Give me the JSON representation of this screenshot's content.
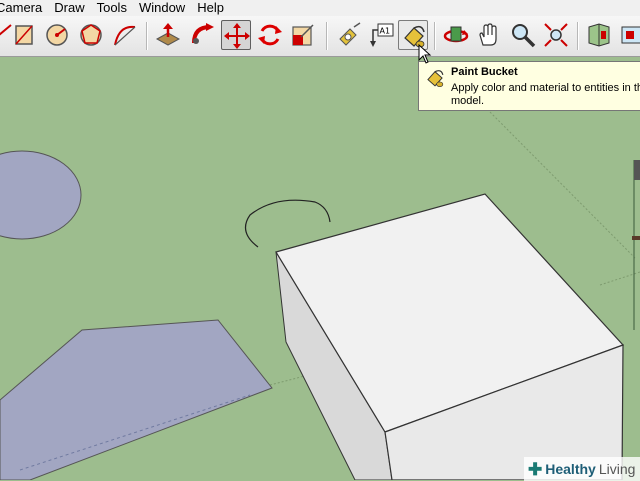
{
  "menu": {
    "items": [
      "Camera",
      "Draw",
      "Tools",
      "Window",
      "Help"
    ]
  },
  "toolbar": {
    "tools": [
      "rectangle-icon",
      "circle-icon",
      "polygon-icon",
      "arc-icon",
      "push-pull-icon",
      "follow-me-icon",
      "move-icon",
      "rotate-icon",
      "scale-icon",
      "tape-measure-icon",
      "text-icon",
      "paint-bucket-icon",
      "orbit-icon",
      "pan-icon",
      "zoom-icon",
      "zoom-extents-icon",
      "components-icon",
      "styles-icon"
    ],
    "text_tool_label": "A1",
    "active_tool": "paint-bucket-icon",
    "pressed_tool": "move-icon"
  },
  "tooltip": {
    "title": "Paint Bucket",
    "text": "Apply color and material to entities in the model."
  },
  "canvas": {
    "background_color": "#9dbd8e",
    "face_color": "#a2a6c2",
    "box_top_color": "#f1f1f1",
    "box_side_color": "#d9d9d9"
  },
  "watermark": {
    "brand_bold": "Healthy",
    "brand_light": "Living"
  }
}
